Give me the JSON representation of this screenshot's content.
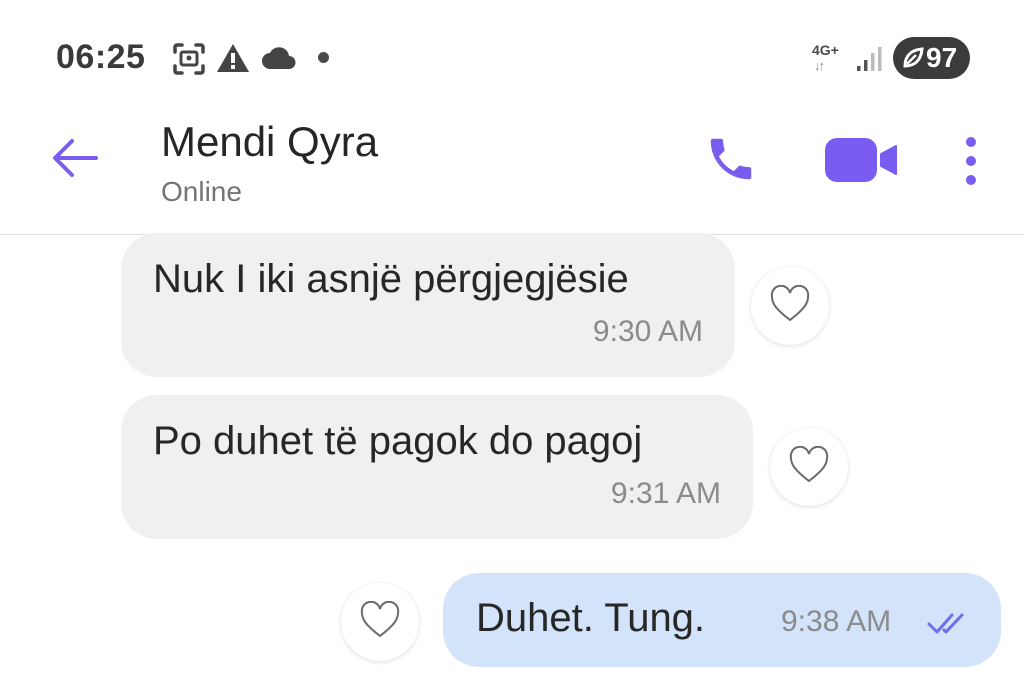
{
  "status_bar": {
    "time": "06:25",
    "network": "4G+",
    "battery": "97",
    "icons": [
      "screenshot-icon",
      "warning-icon",
      "cloud-icon",
      "notification-dot",
      "signal-icon",
      "battery-icon"
    ]
  },
  "header": {
    "contact_name": "Mendi Qyra",
    "contact_status": "Online",
    "icons": [
      "back-arrow-icon",
      "phone-icon",
      "video-camera-icon",
      "more-vertical-icon"
    ]
  },
  "messages": [
    {
      "direction": "incoming",
      "text": "Nuk I iki asnjë përgjegjësie",
      "time": "9:30 AM"
    },
    {
      "direction": "incoming",
      "text": "Po duhet të pagok do pagoj",
      "time": "9:31 AM"
    },
    {
      "direction": "outgoing",
      "text": "Duhet. Tung.",
      "time": "9:38 AM",
      "read_icon": "double-check-icon"
    }
  ],
  "colors": {
    "accent": "#7b5cf0",
    "incoming_bubble": "#f0eff2",
    "outgoing_bubble": "#d3e4fa"
  }
}
